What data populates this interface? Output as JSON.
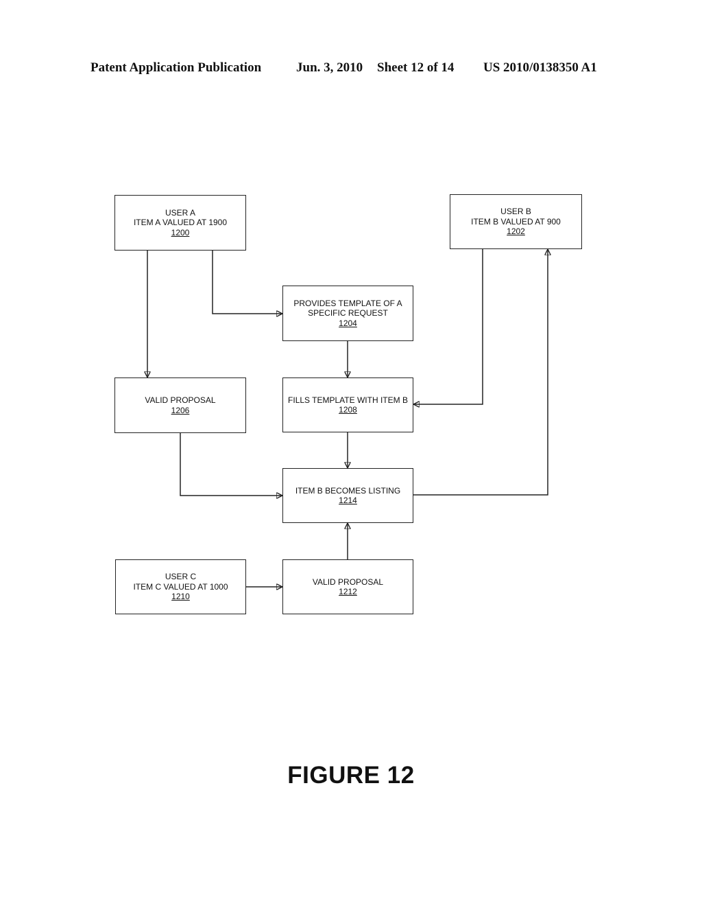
{
  "header": {
    "publication": "Patent Application Publication",
    "date": "Jun. 3, 2010",
    "sheet": "Sheet 12 of 14",
    "number": "US 2010/0138350 A1"
  },
  "nodes": {
    "n1200": {
      "lines": [
        "USER A",
        "ITEM A VALUED AT 1900"
      ],
      "ref": "1200"
    },
    "n1202": {
      "lines": [
        "USER B",
        "ITEM B VALUED AT 900"
      ],
      "ref": "1202"
    },
    "n1204": {
      "lines": [
        "PROVIDES TEMPLATE OF A",
        "SPECIFIC REQUEST"
      ],
      "ref": "1204"
    },
    "n1206": {
      "lines": [
        "VALID PROPOSAL"
      ],
      "ref": "1206"
    },
    "n1208": {
      "lines": [
        "FILLS TEMPLATE WITH ITEM B"
      ],
      "ref": "1208"
    },
    "n1214": {
      "lines": [
        "ITEM B BECOMES LISTING"
      ],
      "ref": "1214"
    },
    "n1210": {
      "lines": [
        "USER C",
        "ITEM C VALUED AT 1000"
      ],
      "ref": "1210"
    },
    "n1212": {
      "lines": [
        "VALID PROPOSAL"
      ],
      "ref": "1212"
    }
  },
  "edges": [
    {
      "from": "1200",
      "to": "1206"
    },
    {
      "from": "1200",
      "to": "1204"
    },
    {
      "from": "1204",
      "to": "1208"
    },
    {
      "from": "1202",
      "to": "1208"
    },
    {
      "from": "1208",
      "to": "1214"
    },
    {
      "from": "1206",
      "to": "1214"
    },
    {
      "from": "1214",
      "to": "1202"
    },
    {
      "from": "1210",
      "to": "1212"
    },
    {
      "from": "1212",
      "to": "1214"
    }
  ],
  "caption": "FIGURE 12"
}
